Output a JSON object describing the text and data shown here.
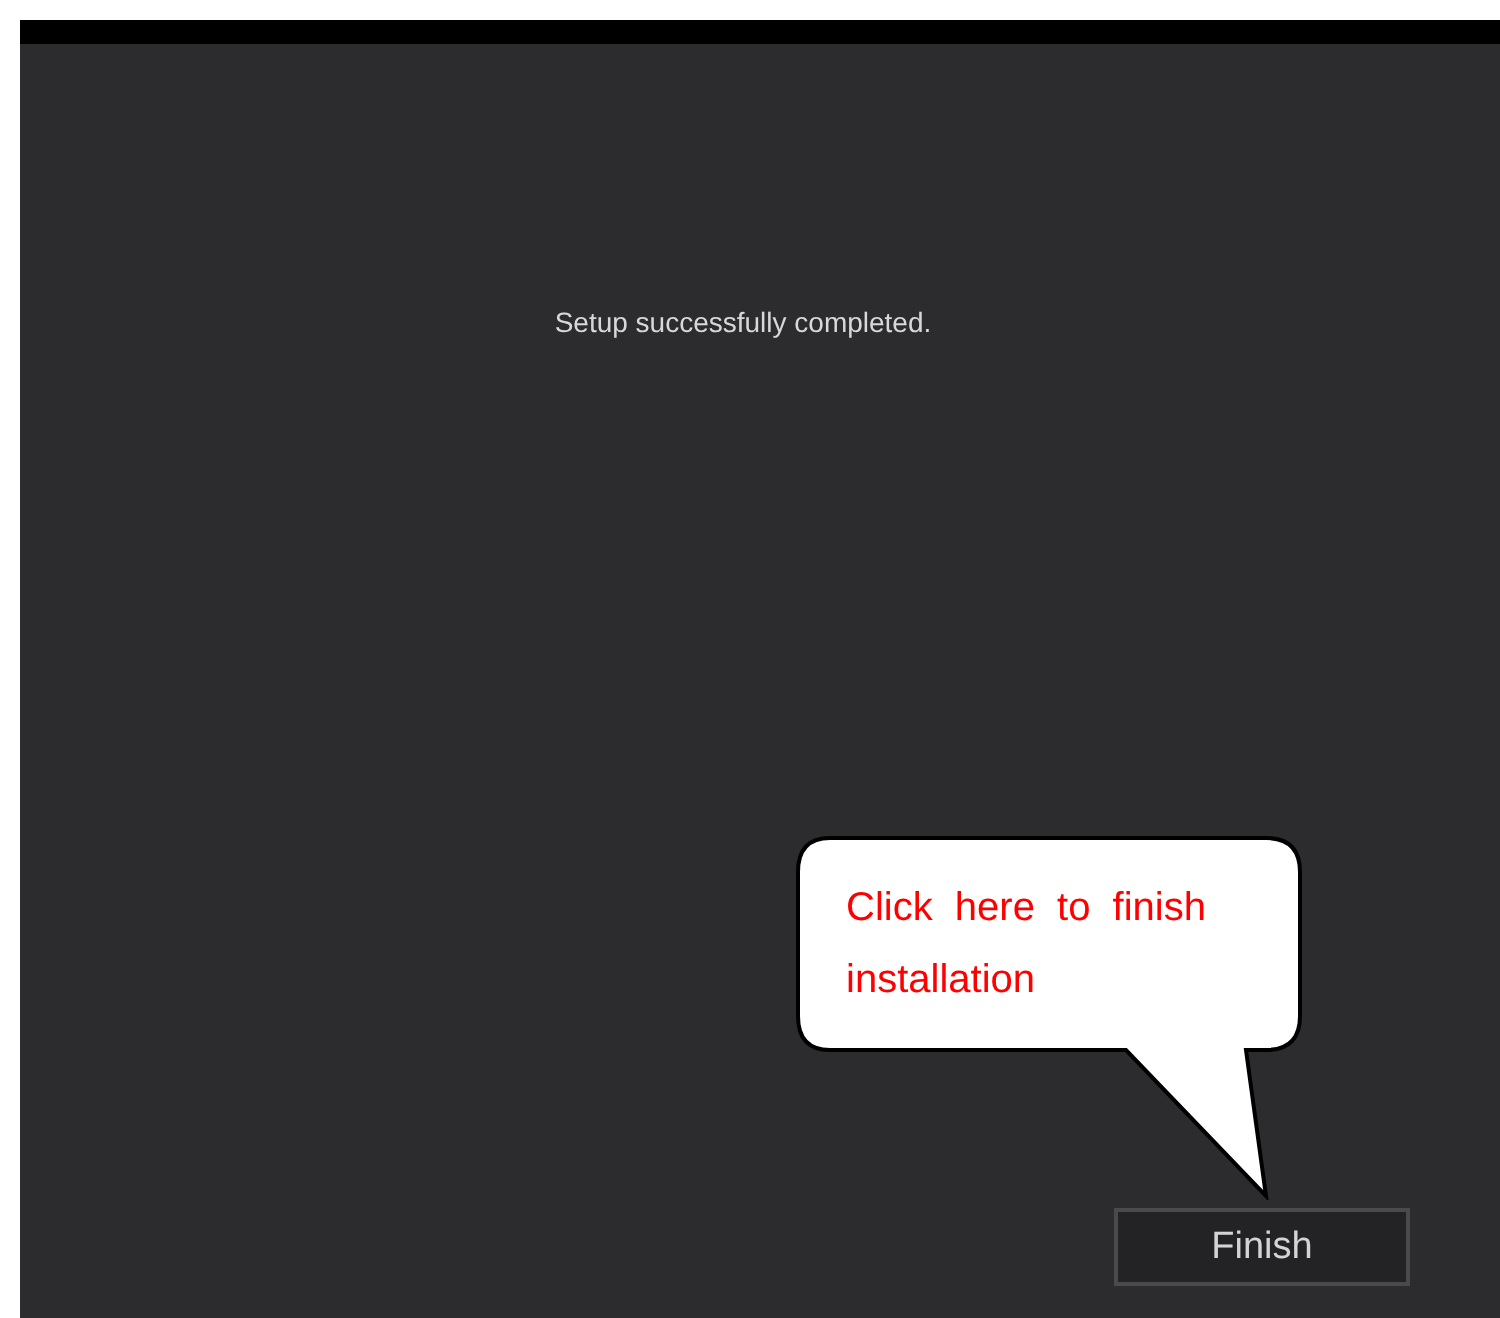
{
  "message": "Setup successfully completed.",
  "callout": {
    "text": "Click here to finish installation"
  },
  "buttons": [
    {
      "label": "Finish"
    }
  ]
}
